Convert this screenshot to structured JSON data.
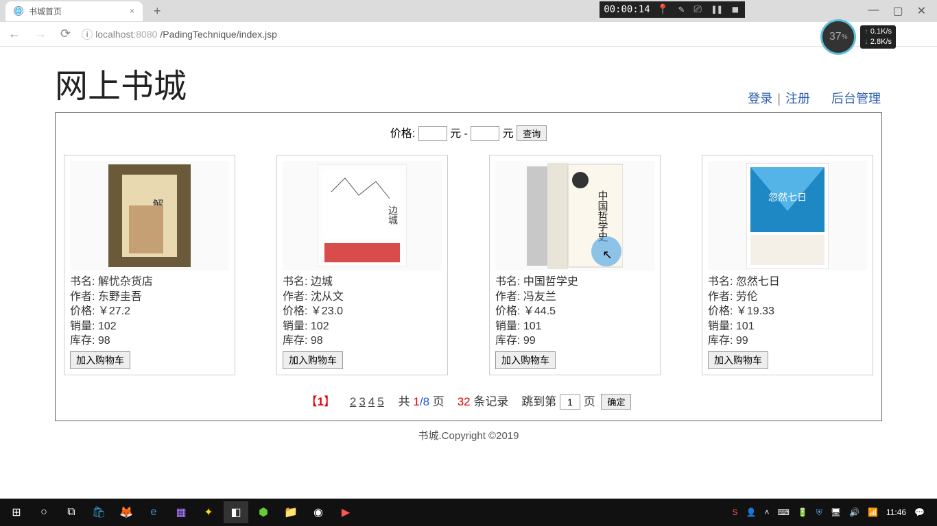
{
  "browser": {
    "tab_title": "书城首页",
    "url_info": "i",
    "url_host": "localhost",
    "url_port": ":8080",
    "url_path": "/PadingTechnique/index.jsp"
  },
  "recorder": {
    "time": "00:00:14"
  },
  "speed": {
    "pct": "37",
    "up": "0.1K/s",
    "down": "2.8K/s"
  },
  "header": {
    "title": "网上书城",
    "login": "登录",
    "register": "注册",
    "admin": "后台管理"
  },
  "filter": {
    "label_price": "价格:",
    "unit": "元",
    "sep": "-",
    "btn": "查询"
  },
  "labels": {
    "name": "书名:",
    "author": "作者:",
    "price": "价格:",
    "sales": "销量:",
    "stock": "库存:",
    "add_cart": "加入购物车"
  },
  "books": [
    {
      "name": "解忧杂货店",
      "author": "东野圭吾",
      "price": "￥27.2",
      "sales": "102",
      "stock": "98"
    },
    {
      "name": "边城",
      "author": "沈从文",
      "price": "￥23.0",
      "sales": "102",
      "stock": "98"
    },
    {
      "name": "中国哲学史",
      "author": "冯友兰",
      "price": "￥44.5",
      "sales": "101",
      "stock": "99"
    },
    {
      "name": "忽然七日",
      "author": "劳伦",
      "price": "￥19.33",
      "sales": "101",
      "stock": "99"
    }
  ],
  "pagination": {
    "current": "1",
    "pages": [
      "2",
      "3",
      "4",
      "5"
    ],
    "total_label_pre": "共 ",
    "cur_page": "1",
    "slash": "/",
    "total_pages": "8",
    "page_word": " 页",
    "total_records": "32",
    "record_word": " 条记录",
    "jump_pre": "跳到第",
    "jump_input": "1",
    "jump_post": "页",
    "btn": "确定"
  },
  "footer": "书城.Copyright ©2019",
  "taskbar": {
    "time": "11:46"
  }
}
